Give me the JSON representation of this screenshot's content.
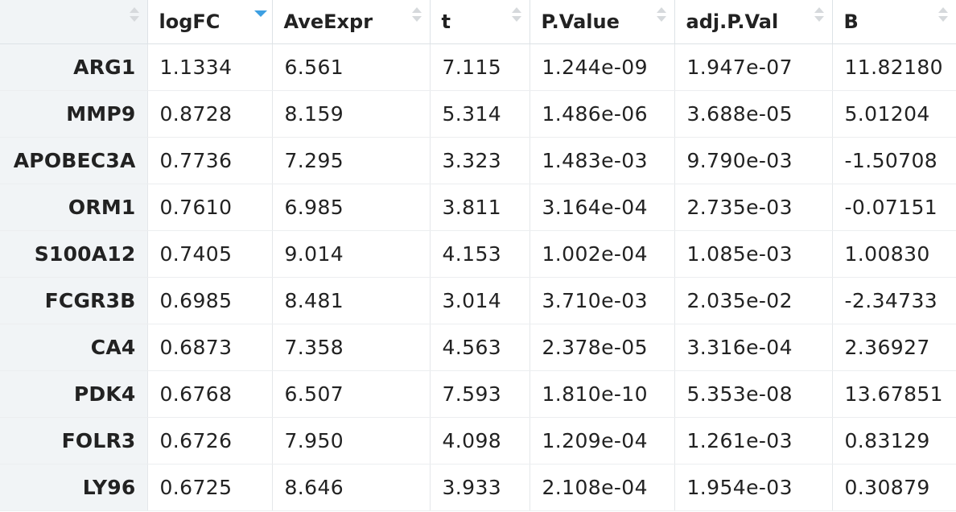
{
  "table": {
    "columns": [
      {
        "label": "",
        "sort": "none"
      },
      {
        "label": "logFC",
        "sort": "desc"
      },
      {
        "label": "AveExpr",
        "sort": "none"
      },
      {
        "label": "t",
        "sort": "none"
      },
      {
        "label": "P.Value",
        "sort": "none"
      },
      {
        "label": "adj.P.Val",
        "sort": "none"
      },
      {
        "label": "B",
        "sort": "none"
      }
    ],
    "rows": [
      [
        "ARG1",
        "1.1334",
        "6.561",
        "7.115",
        "1.244e-09",
        "1.947e-07",
        "11.82180"
      ],
      [
        "MMP9",
        "0.8728",
        "8.159",
        "5.314",
        "1.486e-06",
        "3.688e-05",
        "5.01204"
      ],
      [
        "APOBEC3A",
        "0.7736",
        "7.295",
        "3.323",
        "1.483e-03",
        "9.790e-03",
        "-1.50708"
      ],
      [
        "ORM1",
        "0.7610",
        "6.985",
        "3.811",
        "3.164e-04",
        "2.735e-03",
        "-0.07151"
      ],
      [
        "S100A12",
        "0.7405",
        "9.014",
        "4.153",
        "1.002e-04",
        "1.085e-03",
        "1.00830"
      ],
      [
        "FCGR3B",
        "0.6985",
        "8.481",
        "3.014",
        "3.710e-03",
        "2.035e-02",
        "-2.34733"
      ],
      [
        "CA4",
        "0.6873",
        "7.358",
        "4.563",
        "2.378e-05",
        "3.316e-04",
        "2.36927"
      ],
      [
        "PDK4",
        "0.6768",
        "6.507",
        "7.593",
        "1.810e-10",
        "5.353e-08",
        "13.67851"
      ],
      [
        "FOLR3",
        "0.6726",
        "7.950",
        "4.098",
        "1.209e-04",
        "1.261e-03",
        "0.83129"
      ],
      [
        "LY96",
        "0.6725",
        "8.646",
        "3.933",
        "2.108e-04",
        "1.954e-03",
        "0.30879"
      ]
    ]
  },
  "colors": {
    "rowname_bg": "#f1f4f6",
    "sort_active": "#3d9fe2",
    "sort_inactive": "#d6d9dc",
    "border": "#dde2e6"
  },
  "icons": {
    "sort_inactive": "sort-both-icon",
    "sort_active": "sort-desc-icon"
  }
}
